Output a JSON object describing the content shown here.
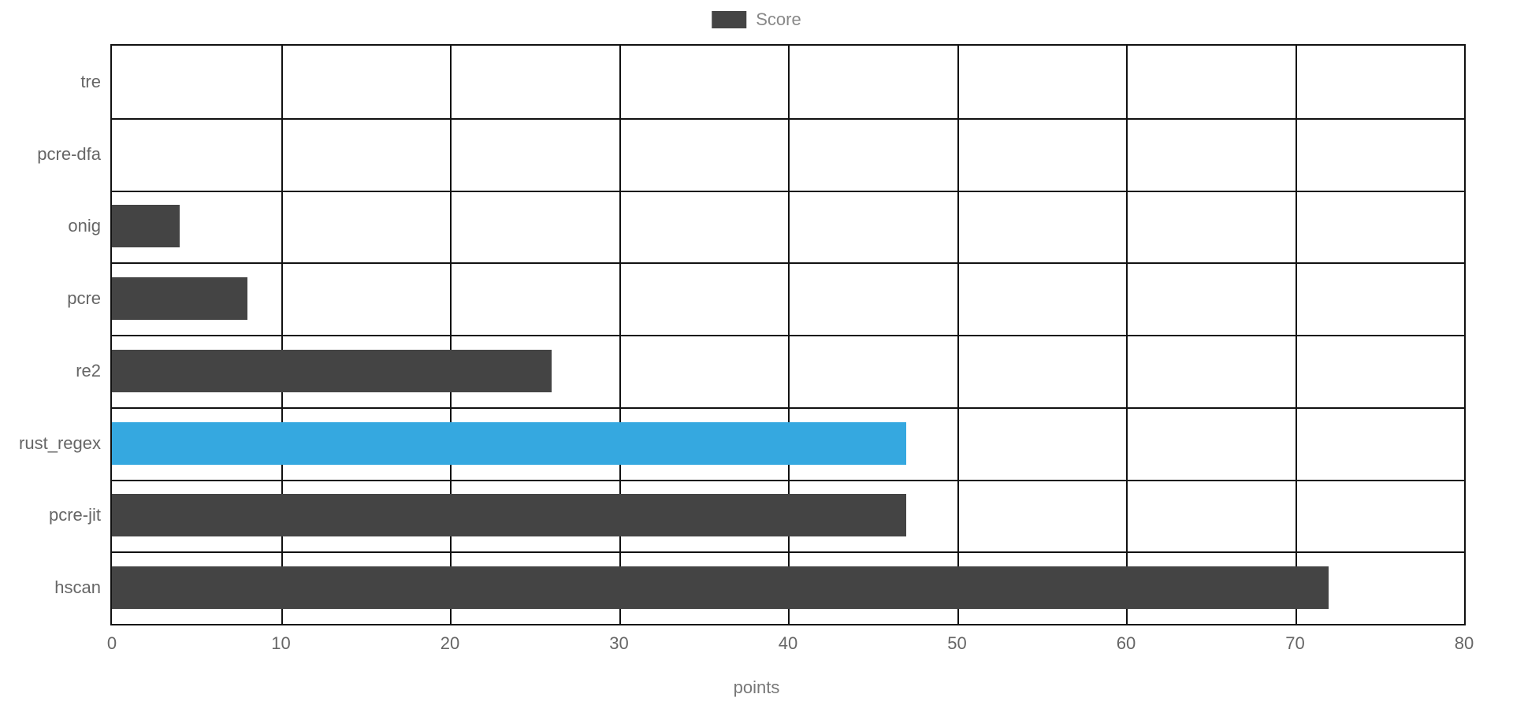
{
  "chart_data": {
    "type": "bar",
    "orientation": "horizontal",
    "categories": [
      "tre",
      "pcre-dfa",
      "onig",
      "pcre",
      "re2",
      "rust_regex",
      "pcre-jit",
      "hscan"
    ],
    "values": [
      0,
      0,
      4,
      8,
      26,
      47,
      47,
      72
    ],
    "highlight_category": "rust_regex",
    "title": "",
    "xlabel": "points",
    "ylabel": "",
    "xlim": [
      0,
      80
    ],
    "xticks": [
      0,
      10,
      20,
      30,
      40,
      50,
      60,
      70,
      80
    ],
    "legend": {
      "label": "Score"
    },
    "colors": {
      "default": "#444444",
      "highlight": "#35a8e0"
    }
  }
}
